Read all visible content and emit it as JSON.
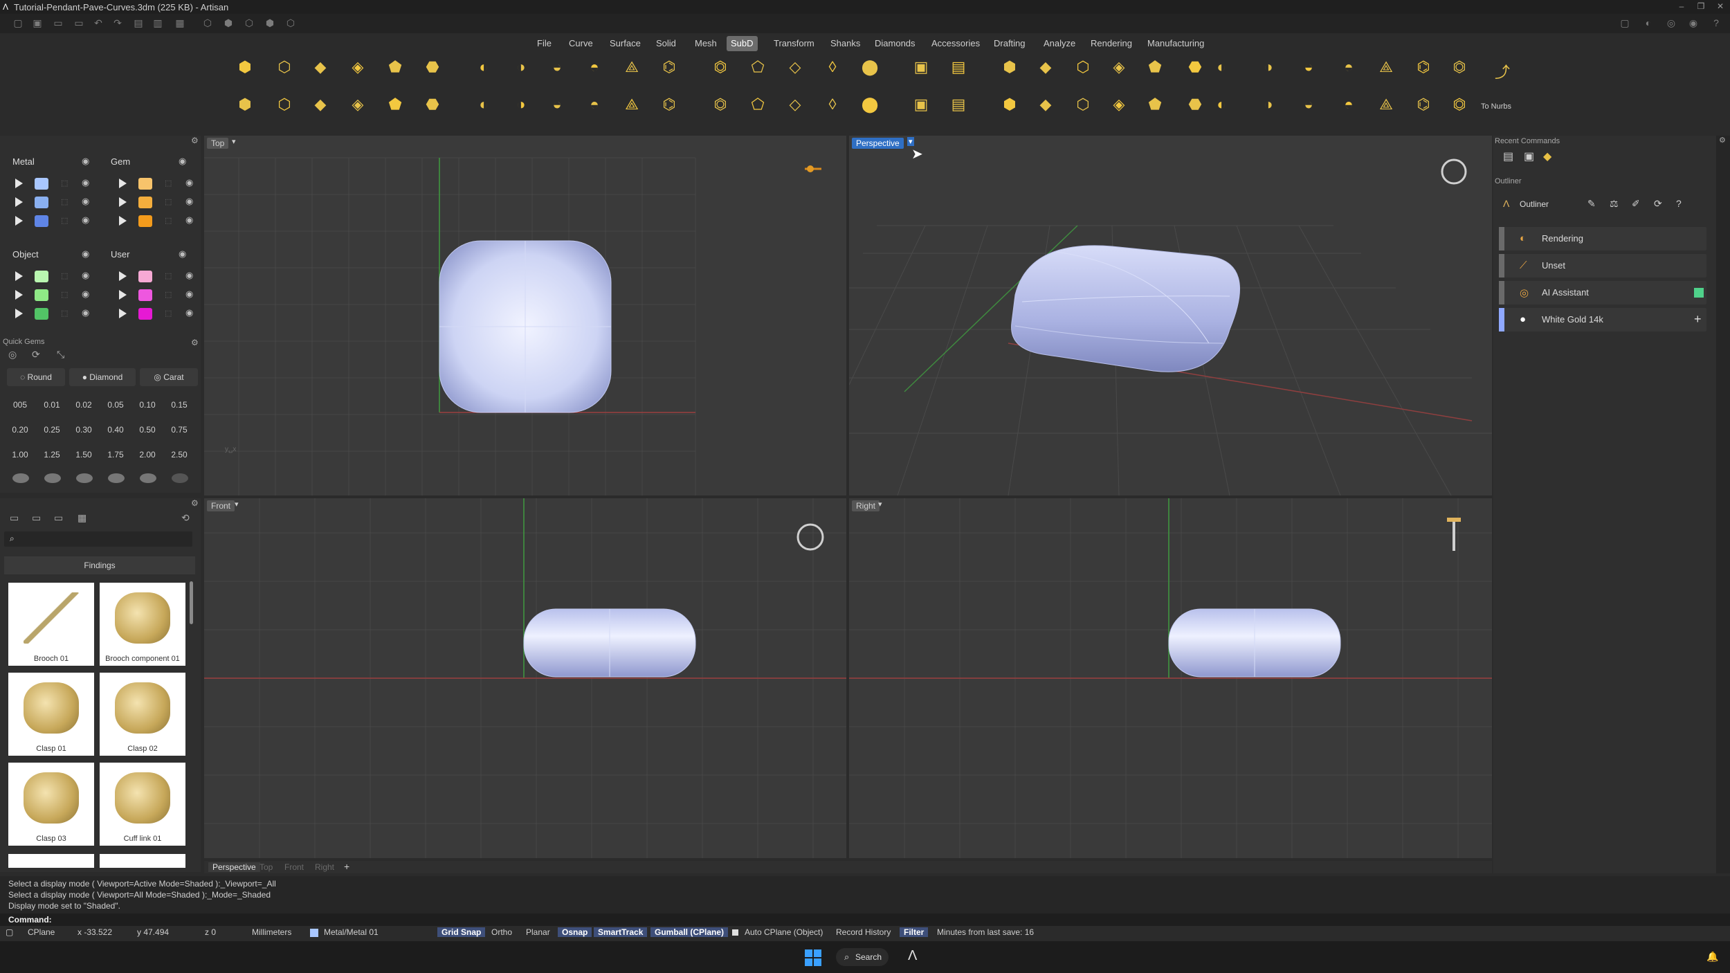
{
  "window": {
    "title": "Tutorial-Pendant-Pave-Curves.3dm (225 KB) - Artisan"
  },
  "menu": [
    "File",
    "Curve",
    "Surface",
    "Solid",
    "Mesh",
    "SubD",
    "Transform",
    "Shanks",
    "Diamonds",
    "Accessories",
    "Drafting",
    "Analyze",
    "Rendering",
    "Manufacturing"
  ],
  "menu_active": "SubD",
  "toolbar": {
    "to_nurbs_label": "To Nurbs"
  },
  "layers": {
    "metal": {
      "label": "Metal",
      "colors": [
        "#a9c7ff",
        "#8ab0f0",
        "#5f85e6"
      ]
    },
    "gem": {
      "label": "Gem",
      "colors": [
        "#f7c36b",
        "#f4ae3d",
        "#f39b1c"
      ]
    },
    "object": {
      "label": "Object",
      "colors": [
        "#b9f6b0",
        "#8fe986",
        "#52c466"
      ]
    },
    "user": {
      "label": "User",
      "colors": [
        "#f6a9d4",
        "#ee57df",
        "#e619d4"
      ]
    }
  },
  "quick_gems": {
    "title": "Quick Gems",
    "shape": "Round",
    "cut": "Diamond",
    "unit": "Carat",
    "values": [
      "005",
      "0.01",
      "0.02",
      "0.05",
      "0.10",
      "0.15",
      "0.20",
      "0.25",
      "0.30",
      "0.40",
      "0.50",
      "0.75",
      "1.00",
      "1.25",
      "1.50",
      "1.75",
      "2.00",
      "2.50"
    ]
  },
  "library": {
    "search_placeholder": "",
    "category": "Findings",
    "items": [
      "Brooch 01",
      "Brooch component 01",
      "Clasp 01",
      "Clasp 02",
      "Clasp 03",
      "Cuff link 01"
    ]
  },
  "viewports": {
    "top": "Top",
    "perspective": "Perspective",
    "front": "Front",
    "right": "Right"
  },
  "viewport_tabs": [
    "Perspective",
    "Top",
    "Front",
    "Right",
    "+"
  ],
  "right_panel": {
    "recent_commands": "Recent Commands",
    "outliner_section": "Outliner",
    "outliner_title": "Outliner",
    "rows": [
      {
        "label": "Rendering",
        "bar": "#6a6a6a"
      },
      {
        "label": "Unset",
        "bar": "#6a6a6a"
      },
      {
        "label": "AI Assistant",
        "bar": "#6a6a6a",
        "tag": "#4fd18a"
      },
      {
        "label": "White Gold 14k",
        "bar": "#8fa8ff",
        "tag_plus": "+"
      }
    ]
  },
  "command_history": [
    "Select a display mode ( Viewport=Active  Mode=Shaded ):_Viewport=_All",
    "Select a display mode ( Viewport=All  Mode=Shaded ):_Mode=_Shaded",
    "Display mode set to \"Shaded\"."
  ],
  "command_prompt": "Command:",
  "status": {
    "cplane": "CPlane",
    "x": "x -33.522",
    "y": "y 47.494",
    "z": "z 0",
    "units": "Millimeters",
    "layer": "Metal/Metal 01",
    "grid_snap": "Grid Snap",
    "ortho": "Ortho",
    "planar": "Planar",
    "osnap": "Osnap",
    "smarttrack": "SmartTrack",
    "gumball": "Gumball (CPlane)",
    "auto_cplane": "Auto CPlane (Object)",
    "record_history": "Record History",
    "filter": "Filter",
    "save": "Minutes from last save: 16"
  },
  "taskbar": {
    "search": "Search"
  }
}
